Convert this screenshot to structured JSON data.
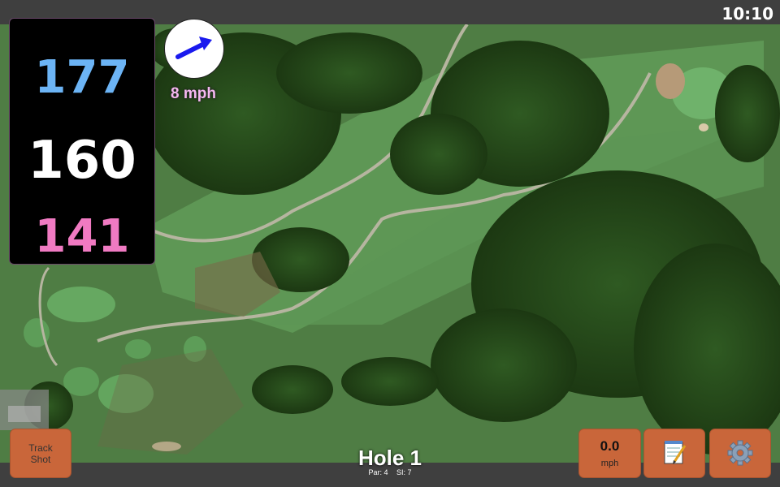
{
  "status": {
    "time": "10:10"
  },
  "distances": {
    "back": "177",
    "middle": "160",
    "front": "141"
  },
  "wind": {
    "speed": "8 mph",
    "icon": "wind-arrow-icon"
  },
  "buttons": {
    "track_shot": "Track Shot",
    "speed_value": "0.0",
    "speed_unit": "mph",
    "notes_icon": "notepad-icon",
    "settings_icon": "gear-icon"
  },
  "hole": {
    "title": "Hole 1",
    "par": "Par: 4",
    "si": "SI: 7"
  },
  "colors": {
    "back_distance": "#6cb4f5",
    "middle_distance": "#ffffff",
    "front_distance": "#f07ac2",
    "button_bg": "#c9663a",
    "wind_text": "#f5b8f0"
  }
}
